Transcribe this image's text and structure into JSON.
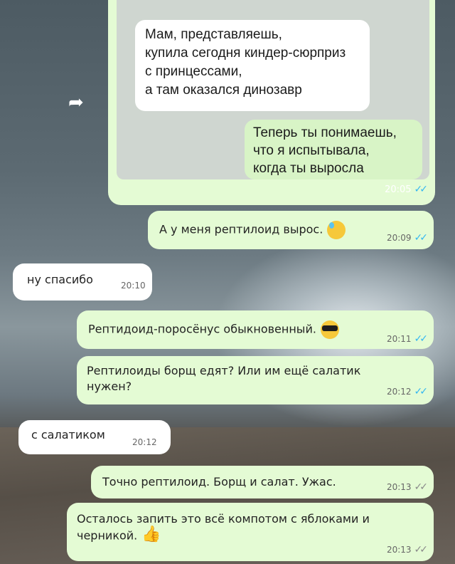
{
  "forwarded": {
    "quote1": "Мам, представляешь,\nкупила сегодня киндер-сюрприз\nс принцессами,\nа там оказался динозавр",
    "quote2": "Теперь ты понимаешь,\nчто я испытывала,\nкогда ты выросла",
    "time": "20:05"
  },
  "messages": [
    {
      "text": "А у меня рептилоид вырос.",
      "time": "20:09",
      "emoji": "sweat-smile-emoji"
    },
    {
      "text": "ну спасибо",
      "time": "20:10"
    },
    {
      "text": "Рептидоид-поросёнус обыкновенный.",
      "time": "20:11",
      "emoji": "sunglasses-emoji"
    },
    {
      "text": "Рептилоиды борщ едят? Или им ещё салатик\nнужен?",
      "time": "20:12"
    },
    {
      "text": "с салатиком",
      "time": "20:12"
    },
    {
      "text": "Точно рептилоид. Борщ и салат. Ужас.",
      "time": "20:13"
    },
    {
      "text": "Осталось запить это всё компотом с яблоками и\nчерникой.",
      "time": "20:13",
      "emoji": "thumbs-up-emoji"
    }
  ],
  "colors": {
    "outgoing": "#e4fbd4",
    "incoming": "#ffffff",
    "read_tick": "#34b7f1",
    "delivered_tick": "#8a8a8a"
  }
}
